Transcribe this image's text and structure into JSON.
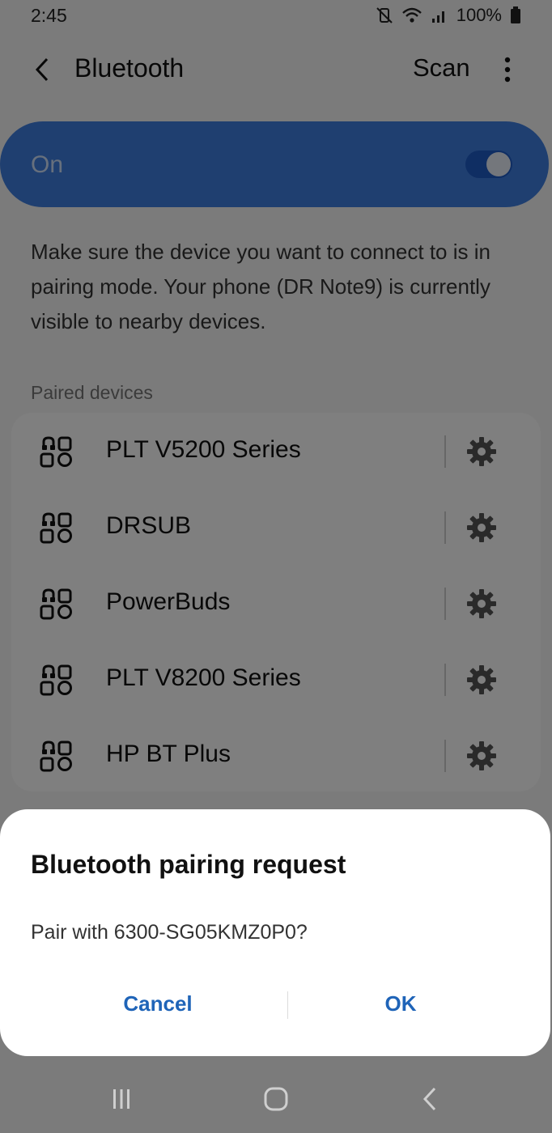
{
  "status_bar": {
    "time": "2:45",
    "battery": "100%",
    "icons": [
      "mute-vibrate-icon",
      "wifi-icon",
      "signal-icon",
      "battery-icon"
    ]
  },
  "app_bar": {
    "title": "Bluetooth",
    "scan_label": "Scan",
    "back_icon": "chevron-left-icon",
    "more_icon": "more-vertical-icon"
  },
  "bluetooth_toggle": {
    "label": "On",
    "state": true
  },
  "description": "Make sure the device you want to connect to is in pairing mode. Your phone (DR Note9) is currently visible to nearby devices.",
  "paired_section": {
    "label": "Paired devices",
    "devices": [
      {
        "name": "PLT V5200 Series",
        "icon": "headset-device-icon"
      },
      {
        "name": "DRSUB",
        "icon": "headset-device-icon"
      },
      {
        "name": "PowerBuds",
        "icon": "headset-device-icon"
      },
      {
        "name": "PLT V8200 Series",
        "icon": "headset-device-icon"
      },
      {
        "name": "HP BT Plus",
        "icon": "headset-device-icon"
      }
    ]
  },
  "dialog": {
    "title": "Bluetooth pairing request",
    "message": "Pair with 6300-SG05KMZ0P0?",
    "cancel_label": "Cancel",
    "ok_label": "OK"
  },
  "colors": {
    "accent": "#3e7fe0",
    "dialog_button": "#1f64b8",
    "scrim": "rgba(0,0,0,0.5)"
  }
}
